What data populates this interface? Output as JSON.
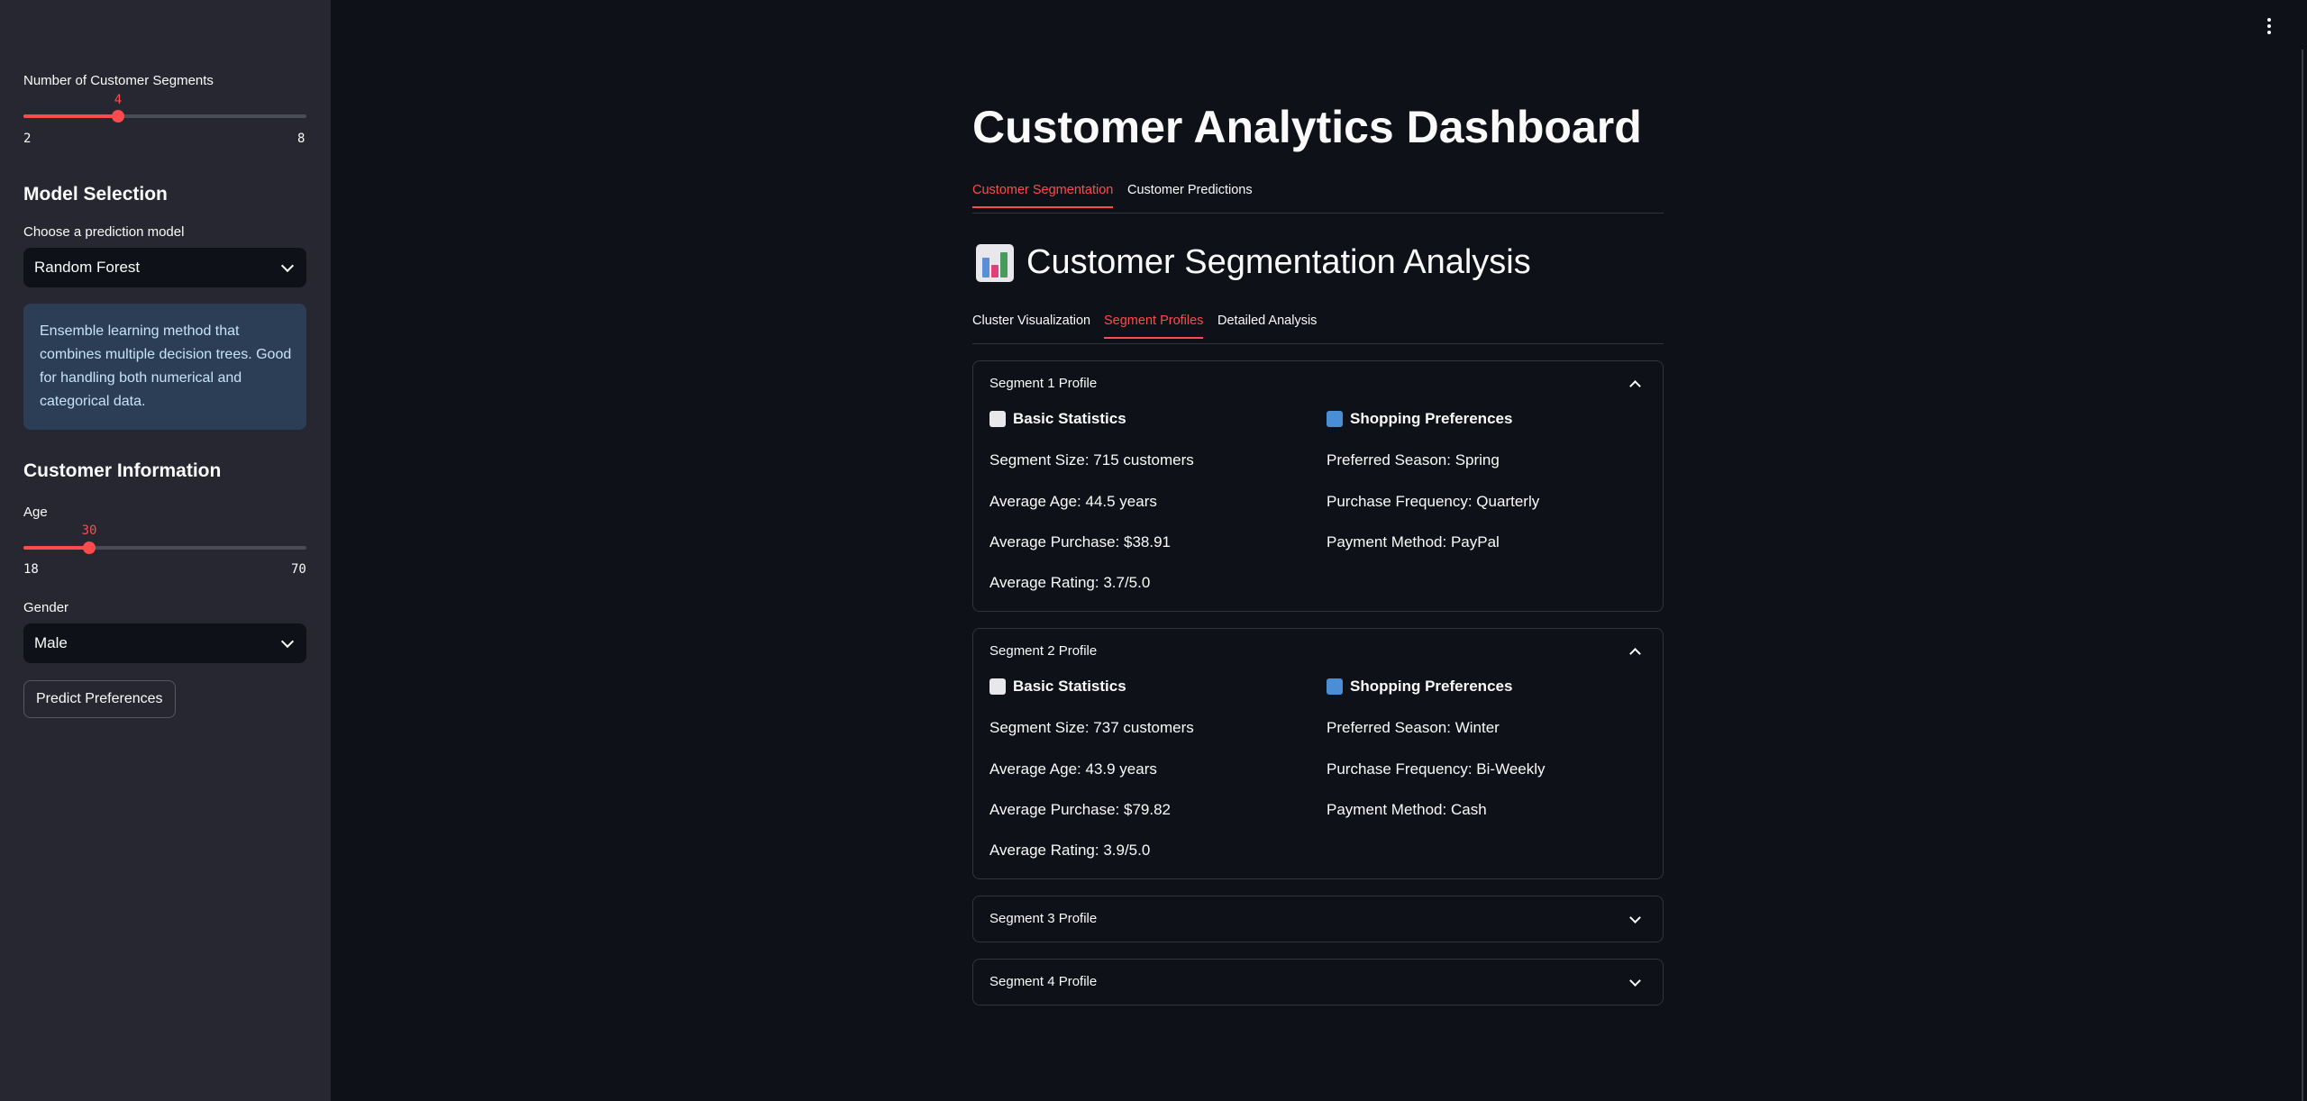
{
  "sidebar": {
    "segments_slider": {
      "label": "Number of Customer Segments",
      "value": "4",
      "min": "2",
      "max": "8",
      "fraction": 0.333
    },
    "model_heading": "Model Selection",
    "model_select": {
      "label": "Choose a prediction model",
      "value": "Random Forest"
    },
    "model_info": "Ensemble learning method that combines multiple decision trees. Good for handling both numerical and categorical data.",
    "customer_heading": "Customer Information",
    "age_slider": {
      "label": "Age",
      "value": "30",
      "min": "18",
      "max": "70",
      "fraction": 0.231
    },
    "gender_select": {
      "label": "Gender",
      "value": "Male"
    },
    "predict_button": "Predict Preferences"
  },
  "main": {
    "title": "Customer Analytics Dashboard",
    "tabs": [
      {
        "label": "Customer Segmentation",
        "active": true
      },
      {
        "label": "Customer Predictions",
        "active": false
      }
    ],
    "section_title": "Customer Segmentation Analysis",
    "subtabs": [
      {
        "label": "Cluster Visualization",
        "active": false
      },
      {
        "label": "Segment Profiles",
        "active": true
      },
      {
        "label": "Detailed Analysis",
        "active": false
      }
    ],
    "segments": [
      {
        "title": "Segment 1 Profile",
        "expanded": true,
        "basic_heading": "Basic Statistics",
        "shopping_heading": "Shopping Preferences",
        "size": "Segment Size: 715 customers",
        "age": "Average Age: 44.5 years",
        "purchase": "Average Purchase: $38.91",
        "rating": "Average Rating: 3.7/5.0",
        "season": "Preferred Season: Spring",
        "frequency": "Purchase Frequency: Quarterly",
        "payment": "Payment Method: PayPal"
      },
      {
        "title": "Segment 2 Profile",
        "expanded": true,
        "basic_heading": "Basic Statistics",
        "shopping_heading": "Shopping Preferences",
        "size": "Segment Size: 737 customers",
        "age": "Average Age: 43.9 years",
        "purchase": "Average Purchase: $79.82",
        "rating": "Average Rating: 3.9/5.0",
        "season": "Preferred Season: Winter",
        "frequency": "Purchase Frequency: Bi-Weekly",
        "payment": "Payment Method: Cash"
      },
      {
        "title": "Segment 3 Profile",
        "expanded": false
      },
      {
        "title": "Segment 4 Profile",
        "expanded": false
      }
    ]
  },
  "colors": {
    "accent": "#ff4b4b",
    "background": "#0e1117",
    "sidebar": "#262730",
    "info": "#2b3e56"
  }
}
